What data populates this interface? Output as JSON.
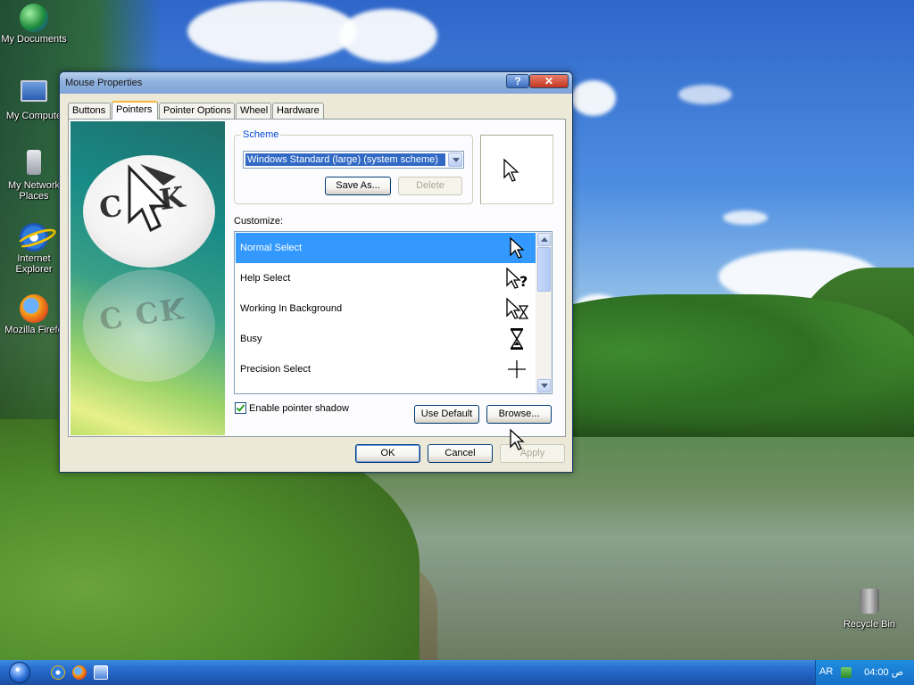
{
  "desktop": {
    "icons": [
      {
        "label": "My Documents",
        "icon": "my-documents-icon"
      },
      {
        "label": "My Compute",
        "icon": "my-computer-icon"
      },
      {
        "label": "My Network Places",
        "icon": "network-places-icon"
      },
      {
        "label": "Internet Explorer",
        "icon": "internet-explorer-icon"
      },
      {
        "label": "Mozilla Firefo",
        "icon": "firefox-icon"
      },
      {
        "label": "Recycle Bin",
        "icon": "recycle-bin-icon"
      }
    ]
  },
  "window": {
    "title": "Mouse Properties",
    "help_label": "?",
    "close_label": "✕",
    "tabs": [
      {
        "label": "Buttons"
      },
      {
        "label": "Pointers",
        "active": true
      },
      {
        "label": "Pointer Options"
      },
      {
        "label": "Wheel"
      },
      {
        "label": "Hardware"
      }
    ],
    "scheme": {
      "group_label": "Scheme",
      "selected": "Windows Standard (large) (system scheme)",
      "save_as_label": "Save As...",
      "delete_label": "Delete"
    },
    "customize_label": "Customize:",
    "cursors": [
      {
        "label": "Normal Select",
        "icon": "arrow-cursor-icon",
        "selected": true
      },
      {
        "label": "Help Select",
        "icon": "help-cursor-icon"
      },
      {
        "label": "Working In Background",
        "icon": "working-cursor-icon"
      },
      {
        "label": "Busy",
        "icon": "hourglass-cursor-icon"
      },
      {
        "label": "Precision Select",
        "icon": "crosshair-cursor-icon"
      }
    ],
    "enable_shadow": {
      "label": "Enable pointer shadow",
      "checked": true
    },
    "use_default_label": "Use Default",
    "browse_label": "Browse...",
    "ok_label": "OK",
    "cancel_label": "Cancel",
    "apply_label": "Apply"
  },
  "taskbar": {
    "language": "AR",
    "time": "04:00 ص"
  }
}
